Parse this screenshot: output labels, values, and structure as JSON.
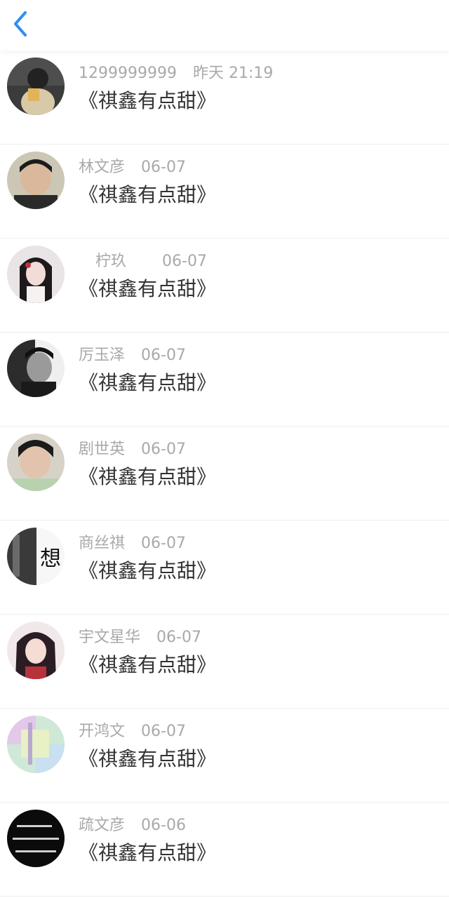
{
  "header": {
    "back_icon": "chevron-left-icon",
    "accent": "#2f8ff0"
  },
  "messages": [
    {
      "name": "1299999999",
      "time": "昨天 21:19",
      "title": "《祺鑫有点甜》"
    },
    {
      "name": "林文彦",
      "time": "06-07",
      "title": "《祺鑫有点甜》"
    },
    {
      "name": "柠玖",
      "time": "06-07",
      "title": "《祺鑫有点甜》"
    },
    {
      "name": "厉玉泽",
      "time": "06-07",
      "title": "《祺鑫有点甜》"
    },
    {
      "name": "剧世英",
      "time": "06-07",
      "title": "《祺鑫有点甜》"
    },
    {
      "name": "商丝祺",
      "time": "06-07",
      "title": "《祺鑫有点甜》",
      "avatar_text": "想"
    },
    {
      "name": "宇文星华",
      "time": "06-07",
      "title": "《祺鑫有点甜》"
    },
    {
      "name": "开鸿文",
      "time": "06-07",
      "title": "《祺鑫有点甜》"
    },
    {
      "name": "疏文彦",
      "time": "06-06",
      "title": "《祺鑫有点甜》"
    }
  ]
}
